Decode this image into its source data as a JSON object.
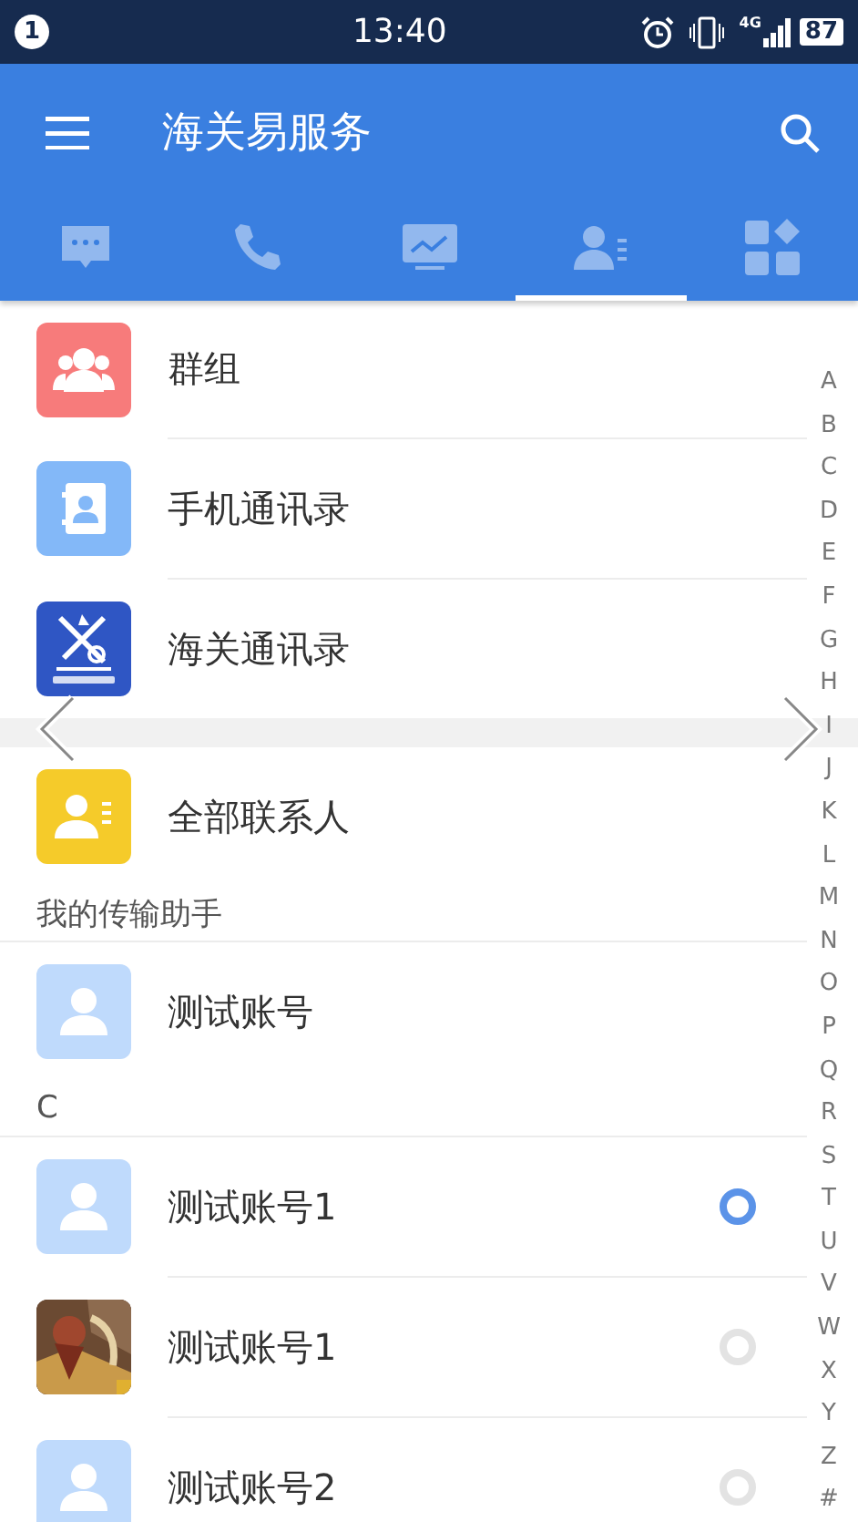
{
  "status_bar": {
    "notification_count": "1",
    "time": "13:40",
    "network": "4G",
    "battery": "87"
  },
  "app_bar": {
    "title": "海关易服务"
  },
  "tabs": [
    {
      "selected": false
    },
    {
      "selected": false
    },
    {
      "selected": false
    },
    {
      "selected": true
    },
    {
      "selected": false
    }
  ],
  "shortcuts": [
    {
      "label": "群组",
      "kind": "group"
    },
    {
      "label": "手机通讯录",
      "kind": "phonebook"
    },
    {
      "label": "海关通讯录",
      "kind": "emblem"
    }
  ],
  "all_contacts": {
    "label": "全部联系人"
  },
  "sections": [
    {
      "header": "我的传输助手",
      "contacts": [
        {
          "name": "测试账号",
          "kind": "default"
        }
      ]
    },
    {
      "header": "C",
      "contacts": [
        {
          "name": "测试账号1",
          "kind": "default",
          "online": true
        },
        {
          "name": "测试账号1",
          "online": false
        },
        {
          "name": "测试账号2",
          "kind": "default",
          "online": false
        }
      ]
    }
  ],
  "index_letters": [
    "A",
    "B",
    "C",
    "D",
    "E",
    "F",
    "G",
    "H",
    "I",
    "J",
    "K",
    "L",
    "M",
    "N",
    "O",
    "P",
    "Q",
    "R",
    "S",
    "T",
    "U",
    "V",
    "W",
    "X",
    "Y",
    "Z",
    "#"
  ]
}
